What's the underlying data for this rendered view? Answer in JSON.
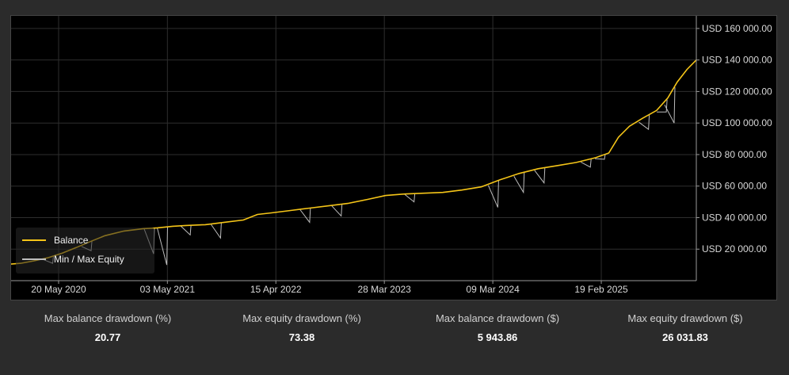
{
  "chart_data": {
    "type": "line",
    "x_tick_labels": [
      "20 May 2020",
      "03 May 2021",
      "15 Apr 2022",
      "28 Mar 2023",
      "09 Mar 2024",
      "19 Feb 2025"
    ],
    "y_tick_labels": [
      "USD 20 000.00",
      "USD 40 000.00",
      "USD 60 000.00",
      "USD 80 000.00",
      "USD 100 000.00",
      "USD 120 000.00",
      "USD 140 000.00",
      "USD 160 000.00"
    ],
    "y_ticks": [
      20000,
      40000,
      60000,
      80000,
      100000,
      120000,
      140000,
      160000
    ],
    "ylim": [
      0,
      168000
    ],
    "xlim": [
      "2019-12-20",
      "2025-12-20"
    ],
    "x_ticks": [
      "2020-05-20",
      "2021-05-03",
      "2022-04-15",
      "2023-03-28",
      "2024-03-09",
      "2025-02-19"
    ],
    "grid": true,
    "legend_position": "bottom-left",
    "series": [
      {
        "name": "Balance",
        "color": "#f5c518",
        "points": [
          [
            "2019-12-20",
            10500
          ],
          [
            "2020-01-20",
            11000
          ],
          [
            "2020-03-01",
            12500
          ],
          [
            "2020-04-15",
            14500
          ],
          [
            "2020-06-01",
            17500
          ],
          [
            "2020-07-15",
            21000
          ],
          [
            "2020-09-01",
            25000
          ],
          [
            "2020-10-15",
            28500
          ],
          [
            "2020-12-15",
            31500
          ],
          [
            "2021-02-15",
            33000
          ],
          [
            "2021-04-01",
            33500
          ],
          [
            "2021-05-20",
            34500
          ],
          [
            "2021-07-01",
            35000
          ],
          [
            "2021-09-01",
            35500
          ],
          [
            "2021-11-01",
            37000
          ],
          [
            "2022-01-01",
            38500
          ],
          [
            "2022-02-15",
            42000
          ],
          [
            "2022-04-01",
            43000
          ],
          [
            "2022-06-01",
            44500
          ],
          [
            "2022-08-01",
            46000
          ],
          [
            "2022-10-01",
            47500
          ],
          [
            "2022-12-01",
            49000
          ],
          [
            "2023-02-01",
            51500
          ],
          [
            "2023-04-01",
            54000
          ],
          [
            "2023-06-01",
            55000
          ],
          [
            "2023-08-01",
            55500
          ],
          [
            "2023-10-01",
            56000
          ],
          [
            "2023-12-01",
            57500
          ],
          [
            "2024-02-01",
            59500
          ],
          [
            "2024-04-01",
            64000
          ],
          [
            "2024-06-01",
            68000
          ],
          [
            "2024-08-01",
            71000
          ],
          [
            "2024-10-01",
            73000
          ],
          [
            "2024-12-01",
            75000
          ],
          [
            "2025-02-01",
            78000
          ],
          [
            "2025-03-15",
            81000
          ],
          [
            "2025-04-15",
            91000
          ],
          [
            "2025-05-20",
            98000
          ],
          [
            "2025-07-01",
            103000
          ],
          [
            "2025-08-15",
            108000
          ],
          [
            "2025-09-20",
            116000
          ],
          [
            "2025-10-20",
            126000
          ],
          [
            "2025-11-20",
            134000
          ],
          [
            "2025-12-20",
            140000
          ]
        ]
      },
      {
        "name": "Min / Max Equity",
        "color": "#bdbdbd",
        "points": [
          [
            "2020-05-01",
            11000
          ],
          [
            "2020-09-01",
            19000
          ],
          [
            "2021-03-20",
            17000
          ],
          [
            "2021-05-01",
            10000
          ],
          [
            "2021-07-15",
            29000
          ],
          [
            "2021-10-20",
            27000
          ],
          [
            "2022-08-01",
            37000
          ],
          [
            "2022-11-10",
            41000
          ],
          [
            "2023-07-01",
            50000
          ],
          [
            "2024-03-25",
            46500
          ],
          [
            "2024-06-15",
            56000
          ],
          [
            "2024-08-20",
            62000
          ],
          [
            "2025-01-15",
            72000
          ],
          [
            "2025-03-01",
            77000
          ],
          [
            "2025-07-20",
            96000
          ],
          [
            "2025-09-15",
            107000
          ],
          [
            "2025-10-10",
            100000
          ]
        ]
      }
    ]
  },
  "stats": [
    {
      "label": "Max balance drawdown (%)",
      "value": "20.77"
    },
    {
      "label": "Max equity drawdown (%)",
      "value": "73.38"
    },
    {
      "label": "Max balance drawdown ($)",
      "value": "5 943.86"
    },
    {
      "label": "Max equity drawdown ($)",
      "value": "26 031.83"
    }
  ]
}
